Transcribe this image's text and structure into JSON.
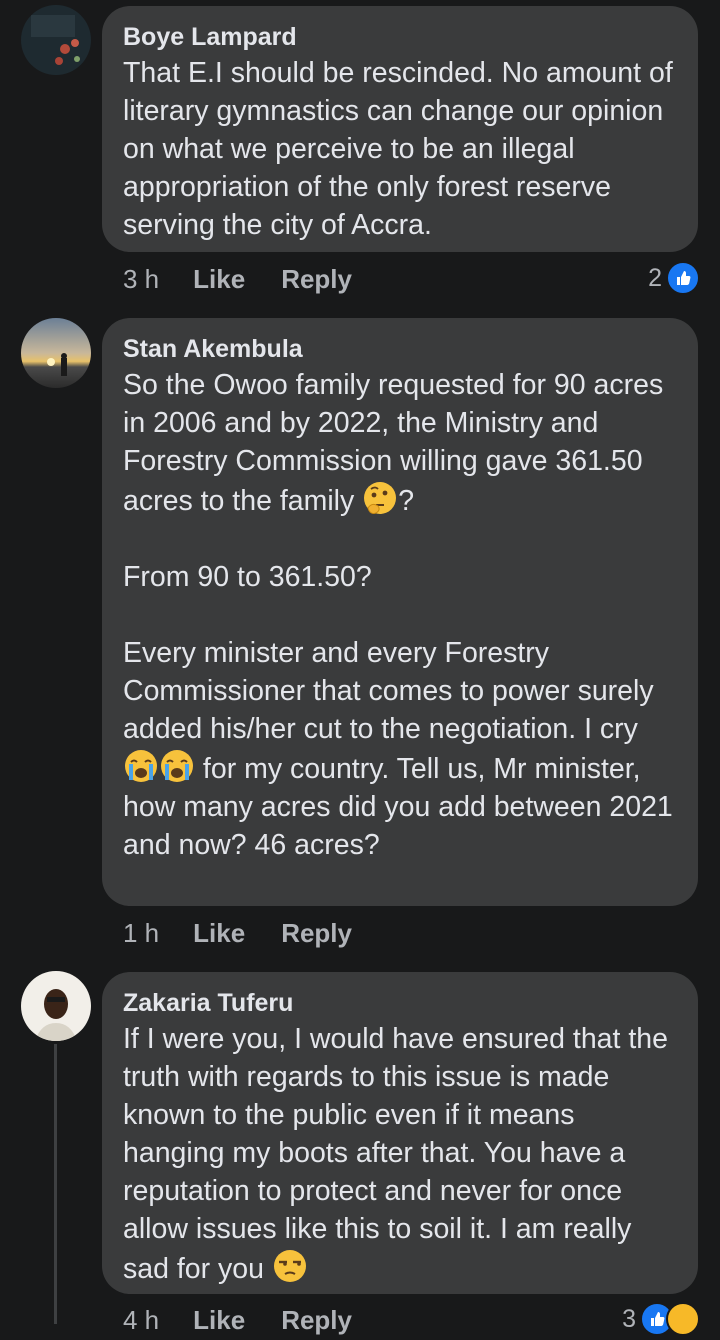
{
  "comments": [
    {
      "author": "Boye Lampard",
      "paragraphs": [
        "That E.I should be rescinded. No amount of literary gymnastics can change our opinion on what we perceive to be an illegal appropriation of the only forest reserve serving the city of Accra."
      ],
      "time": "3 h",
      "like_label": "Like",
      "reply_label": "Reply",
      "reaction_count": "2",
      "reactions": [
        "like-icon"
      ]
    },
    {
      "author": "Stan Akembula",
      "p1_text": "So the Owoo family requested for 90 acres in 2006 and by 2022, the Ministry and Forestry Commission willing gave 361.50 acres to the family",
      "p1_suffix": "?",
      "p2": "From 90 to 361.50?",
      "p3_before": "Every minister and every Forestry Commissioner that comes to power surely added his/her cut to the negotiation. I cry",
      "p3_after": "for my country. Tell us, Mr minister, how many acres did you add between 2021 and now? 46 acres?",
      "time": "1 h",
      "like_label": "Like",
      "reply_label": "Reply"
    },
    {
      "author": "Zakaria Tuferu",
      "text_before": "If I were you, I would have ensured that the truth with regards to this issue is made known to the public even if it means hanging my boots after that. You have a reputation to protect and never for once allow issues like this to soil it. I am really sad for you",
      "time": "4 h",
      "like_label": "Like",
      "reply_label": "Reply",
      "reaction_count": "3",
      "reactions": [
        "like-icon",
        "care-icon"
      ]
    }
  ],
  "colors": {
    "background": "#18191a",
    "bubble": "#3a3b3c",
    "text": "#e4e6eb",
    "secondary": "#b0b3b8",
    "like_blue": "#1877f2"
  }
}
